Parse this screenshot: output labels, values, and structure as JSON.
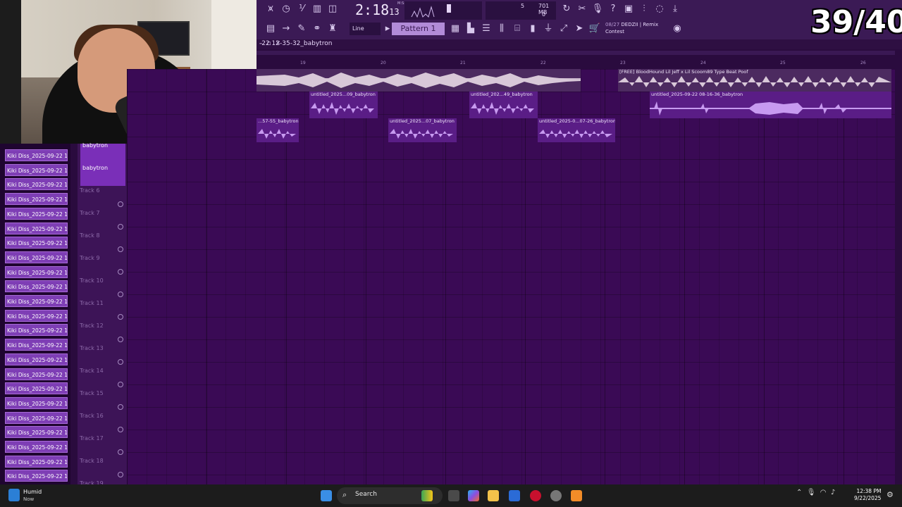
{
  "overlay": {
    "counter": "39/40"
  },
  "toolbar": {
    "time": "2:18",
    "time_frac": "13",
    "time_unit": "M:S:CS",
    "cpu_value": "5",
    "mem": "701 MB",
    "mem2": "0",
    "line_mode": "Line",
    "pattern": "Pattern 1",
    "hint_num": "08/27",
    "hint_title": "DEDZII | Remix",
    "hint_sub": "Contest"
  },
  "playlist": {
    "title": "-22 12-35-32_babytron",
    "ruler": [
      "19",
      "20",
      "21",
      "22",
      "23",
      "24",
      "25",
      "26"
    ],
    "clips": [
      {
        "label": "",
        "kind": "main"
      },
      {
        "label": "[FREE] BloodHound Lil Jeff x Lil Scoom89 Type Beat Poof",
        "kind": "beat"
      },
      {
        "label": "untitled_2025...09_babytron"
      },
      {
        "label": "untitled_202...49_babytron"
      },
      {
        "label": "untitled_2025-09-22 08-16-36_babytron"
      },
      {
        "label": "...57-55_babytron"
      },
      {
        "label": "untitled_2025...07_babytron"
      },
      {
        "label": "untitled_2025-0...07-26_babytron"
      }
    ],
    "babytron_a": "babytron",
    "babytron_b": "babytron",
    "tracks": [
      "Track 6",
      "Track 7",
      "Track 8",
      "Track 9",
      "Track 10",
      "Track 11",
      "Track 12",
      "Track 13",
      "Track 14",
      "Track 15",
      "Track 16",
      "Track 17",
      "Track 18",
      "Track 19"
    ]
  },
  "channels": [
    "Kiki Diss_2025-09-22 12...",
    "Kiki Diss_2025-09-22 12...",
    "Kiki Diss_2025-09-22 12...",
    "Kiki Diss_2025-09-22 12...",
    "Kiki Diss_2025-09-22 12...",
    "Kiki Diss_2025-09-22 12...",
    "Kiki Diss_2025-09-22 12...",
    "Kiki Diss_2025-09-22 12...",
    "Kiki Diss_2025-09-22 12...",
    "Kiki Diss_2025-09-22 12...",
    "Kiki Diss_2025-09-22 12...",
    "Kiki Diss_2025-09-22 12...",
    "Kiki Diss_2025-09-22 12...",
    "Kiki Diss_2025-09-22 12...",
    "Kiki Diss_2025-09-22 12...",
    "Kiki Diss_2025-09-22 12...",
    "Kiki Diss_2025-09-22 12...",
    "Kiki Diss_2025-09-22 12...",
    "Kiki Diss_2025-09-22 12...",
    "Kiki Diss_2025-09-22 12...",
    "Kiki Diss_2025-09-22 12...",
    "Kiki Diss_2025-09-22 12...",
    "Kiki Diss_2025-09-22 12..."
  ],
  "taskbar": {
    "weather_title": "Humid",
    "weather_sub": "Now",
    "search": "Search",
    "time": "12:38 PM",
    "date": "9/22/2025"
  }
}
